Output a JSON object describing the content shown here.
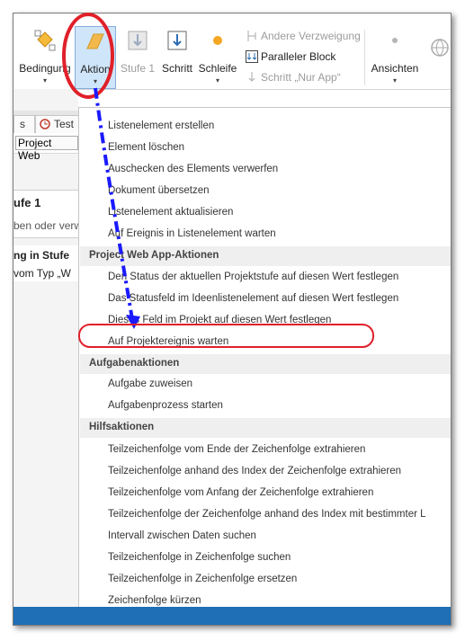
{
  "ribbon": {
    "buttons": {
      "bedingung": "Bedingung",
      "aktion": "Aktion",
      "stufe": "Stufe 1",
      "schritt": "Schritt",
      "schleife": "Schleife",
      "ansichten": "Ansichten"
    },
    "small_buttons": {
      "andere_verzweigung": "Andere Verzweigung",
      "paralleler_block": "Paralleler Block",
      "schritt_nur_app": "Schritt „Nur App“"
    },
    "dropdown_arrow": "▾"
  },
  "left_panel": {
    "tabs": [
      "s",
      "Test"
    ],
    "breadcrumb": "Project Web",
    "stage_title": "ufe 1",
    "line1": "ben oder verw",
    "heading2": "ng in Stufe",
    "line2": "vom Typ „W"
  },
  "menu": {
    "list_items": [
      "Listenelement erstellen",
      "Element löschen",
      "Auschecken des Elements verwerfen",
      "Dokument übersetzen",
      "Listenelement aktualisieren",
      "Auf Ereignis in Listenelement warten"
    ],
    "project_header": "Project Web App-Aktionen",
    "project_items": [
      "Den Status der aktuellen Projektstufe auf diesen Wert festlegen",
      "Das Statusfeld im Ideenlistenelement auf diesen Wert festlegen",
      "Dieses Feld im Projekt auf diesen Wert festlegen",
      "Auf Projektereignis warten"
    ],
    "task_header": "Aufgabenaktionen",
    "task_items": [
      "Aufgabe zuweisen",
      "Aufgabenprozess starten"
    ],
    "helper_header": "Hilfsaktionen",
    "helper_items": [
      "Teilzeichenfolge vom Ende der Zeichenfolge extrahieren",
      "Teilzeichenfolge anhand des Index der Zeichenfolge extrahieren",
      "Teilzeichenfolge vom Anfang der Zeichenfolge extrahieren",
      "Teilzeichenfolge der Zeichenfolge anhand des Index mit bestimmter L",
      "Intervall zwischen Daten suchen",
      "Teilzeichenfolge in Zeichenfolge suchen",
      "Teilzeichenfolge in Zeichenfolge ersetzen",
      "Zeichenfolge kürzen"
    ]
  },
  "colors": {
    "annotation_red": "#e0202a",
    "arrow_blue": "#1a1aff",
    "selected_bg": "#cfe6fa"
  }
}
